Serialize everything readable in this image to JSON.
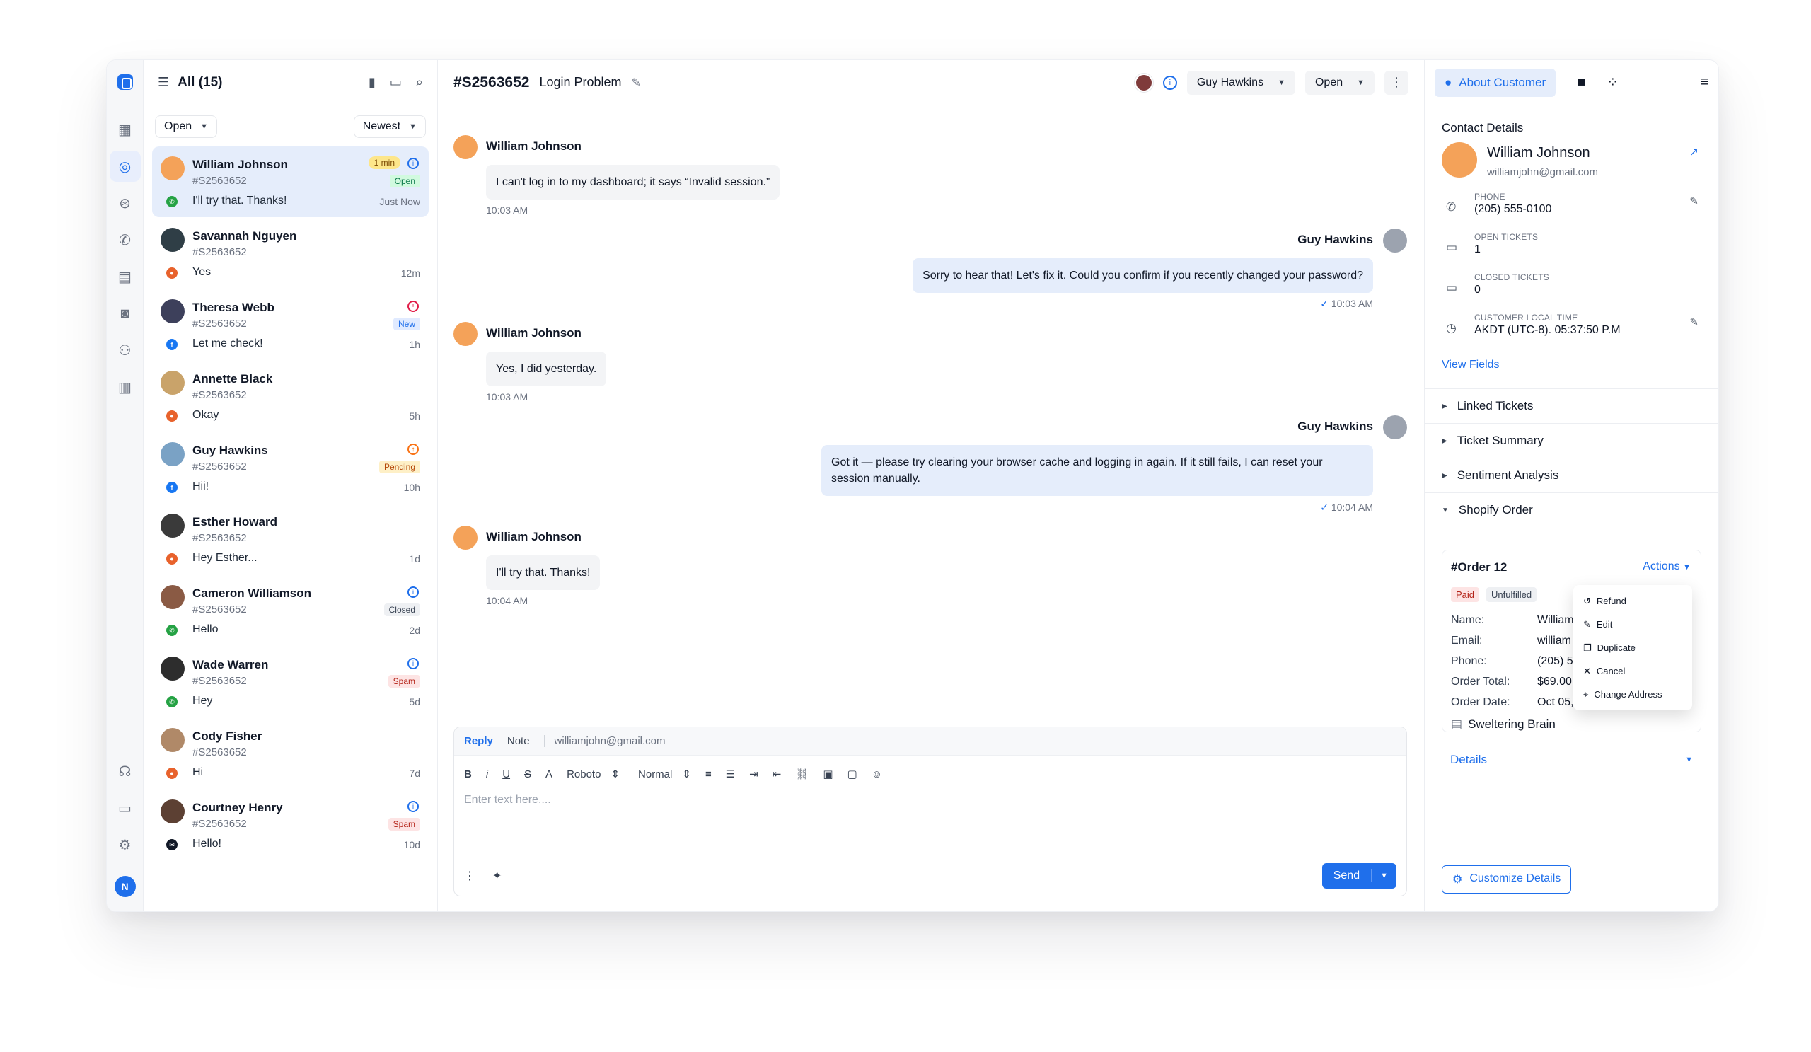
{
  "list": {
    "title": "All (15)",
    "filter_status": "Open",
    "filter_sort": "Newest",
    "conversations": [
      {
        "name": "William Johnson",
        "id": "#S2563652",
        "msg": "I'll try that. Thanks!",
        "time": "Just Now",
        "badge": "Open",
        "timer": "1 min",
        "channel": "whatsapp"
      },
      {
        "name": "Savannah Nguyen",
        "id": "#S2563652",
        "msg": "Yes",
        "time": "12m",
        "badge": "",
        "channel": "chat"
      },
      {
        "name": "Theresa Webb",
        "id": "#S2563652",
        "msg": "Let me check!",
        "time": "1h",
        "badge": "New",
        "channel": "facebook"
      },
      {
        "name": "Annette Black",
        "id": "#S2563652",
        "msg": "Okay",
        "time": "5h",
        "badge": "",
        "channel": "chat"
      },
      {
        "name": "Guy Hawkins",
        "id": "#S2563652",
        "msg": "Hii!",
        "time": "10h",
        "badge": "Pending",
        "channel": "facebook"
      },
      {
        "name": "Esther Howard",
        "id": "#S2563652",
        "msg": "Hey Esther...",
        "time": "1d",
        "badge": "",
        "channel": "chat"
      },
      {
        "name": "Cameron Williamson",
        "id": "#S2563652",
        "msg": "Hello",
        "time": "2d",
        "badge": "Closed",
        "channel": "whatsapp"
      },
      {
        "name": "Wade Warren",
        "id": "#S2563652",
        "msg": "Hey",
        "time": "5d",
        "badge": "Spam",
        "channel": "whatsapp"
      },
      {
        "name": "Cody Fisher",
        "id": "#S2563652",
        "msg": "Hi",
        "time": "7d",
        "badge": "",
        "channel": "chat"
      },
      {
        "name": "Courtney Henry",
        "id": "#S2563652",
        "msg": "Hello!",
        "time": "10d",
        "badge": "Spam",
        "channel": "email"
      }
    ]
  },
  "rail": {
    "avatar_initial": "N"
  },
  "ticket": {
    "id": "#S2563652",
    "subject": "Login Problem",
    "assignee": "Guy Hawkins",
    "status": "Open"
  },
  "messages": [
    {
      "from": "William Johnson",
      "text": "I can't log in to my dashboard; it says “Invalid session.”",
      "time": "10:03 AM",
      "dir": "in"
    },
    {
      "from": "Guy Hawkins",
      "text": "Sorry to hear that! Let's fix it. Could you confirm if you recently changed your password?",
      "time": "10:03 AM",
      "dir": "out"
    },
    {
      "from": "William Johnson",
      "text": "Yes, I did yesterday.",
      "time": "10:03 AM",
      "dir": "in"
    },
    {
      "from": "Guy Hawkins",
      "text": "Got it — please try clearing your browser cache and logging in again. If it still fails, I can reset your session manually.",
      "time": "10:04 AM",
      "dir": "out"
    },
    {
      "from": "William Johnson",
      "text": "I'll try that. Thanks!",
      "time": "10:04 AM",
      "dir": "in"
    }
  ],
  "composer": {
    "tab_reply": "Reply",
    "tab_note": "Note",
    "to": "williamjohn@gmail.com",
    "font": "Roboto",
    "size": "Normal",
    "placeholder": "Enter text here....",
    "send": "Send"
  },
  "panel": {
    "about_tab": "About Customer",
    "contact_title": "Contact Details",
    "customer_name": "William Johnson",
    "customer_email": "williamjohn@gmail.com",
    "fields": [
      {
        "label": "PHONE",
        "value": "(205) 555-0100"
      },
      {
        "label": "OPEN TICKETS",
        "value": "1"
      },
      {
        "label": "CLOSED TICKETS",
        "value": "0"
      },
      {
        "label": "CUSTOMER LOCAL TIME",
        "value": "AKDT (UTC-8). 05:37:50 P.M"
      }
    ],
    "view_fields": "View Fields",
    "sections": [
      "Linked Tickets",
      "Ticket Summary",
      "Sentiment Analysis",
      "Shopify Order"
    ],
    "order": {
      "title": "#Order 12",
      "actions": "Actions",
      "tag_paid": "Paid",
      "tag_unfulfilled": "Unfulfilled",
      "rows": [
        {
          "label": "Name:",
          "value": "William"
        },
        {
          "label": "Email:",
          "value": "william"
        },
        {
          "label": "Phone:",
          "value": "(205) 5"
        },
        {
          "label": "Order Total:",
          "value": "$69.00"
        },
        {
          "label": "Order Date:",
          "value": "Oct 05,"
        }
      ],
      "product": "Sweltering Brain",
      "details": "Details",
      "menu": [
        "Refund",
        "Edit",
        "Duplicate",
        "Cancel",
        "Change Address"
      ]
    },
    "customize": "Customize Details"
  }
}
